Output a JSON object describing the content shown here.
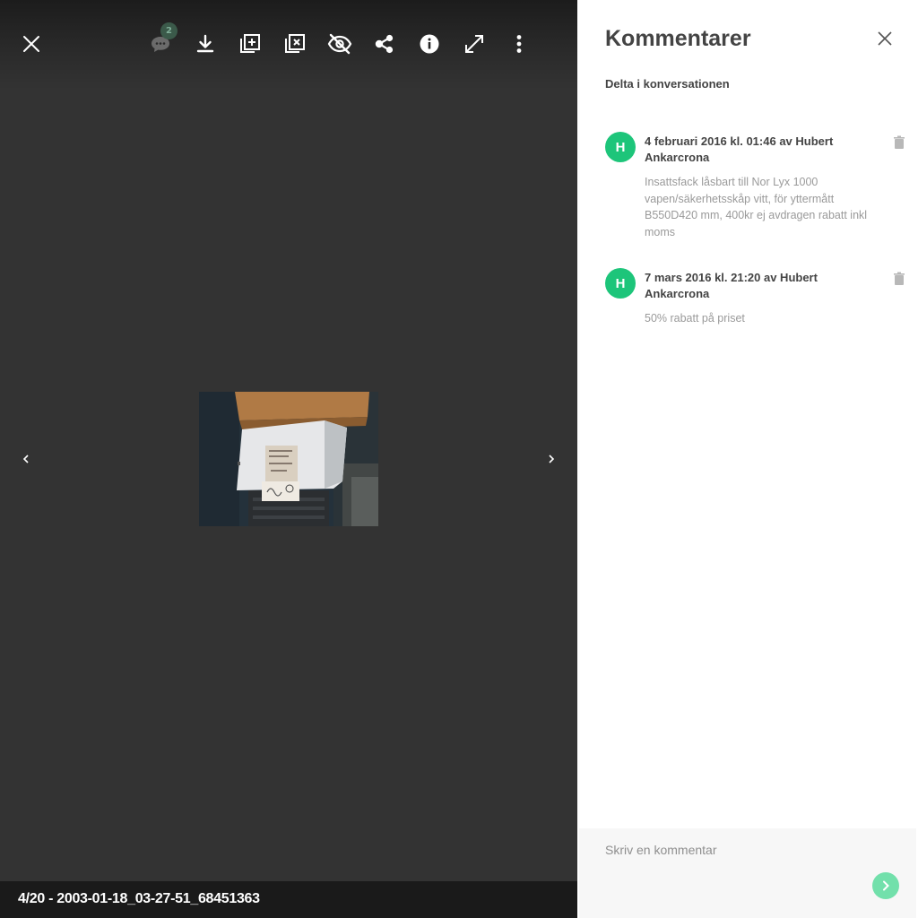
{
  "viewer": {
    "comment_count": "2",
    "footer_title": "4/20 - 2003-01-18_03-27-51_68451363",
    "icons": {
      "close": "close-icon",
      "comments": "comment-icon",
      "download": "download-icon",
      "add_to_album": "add-to-album-icon",
      "remove_from_album": "remove-from-album-icon",
      "hide": "eye-off-icon",
      "share": "share-icon",
      "info": "info-icon",
      "fullscreen": "fullscreen-icon",
      "more": "more-vertical-icon",
      "prev": "chevron-left-icon",
      "next": "chevron-right-icon"
    }
  },
  "panel": {
    "title": "Kommentarer",
    "subtitle": "Delta i konversationen",
    "comments": [
      {
        "initial": "H",
        "meta": "4 februari 2016 kl. 01:46 av Hubert Ankarcrona",
        "text": "Insattsfack låsbart till Nor Lyx 1000 vapen/säkerhetsskåp vitt, för yttermått B550D420 mm, 400kr ej avdragen rabatt inkl moms"
      },
      {
        "initial": "H",
        "meta": "7 mars 2016 kl. 21:20 av Hubert Ankarcrona",
        "text": "50% rabatt på priset"
      }
    ],
    "input_placeholder": "Skriv en kommentar"
  },
  "colors": {
    "viewer_bg": "#333333",
    "avatar": "#1dc57a",
    "send_button": "#72e0ab",
    "badge": "#3b5a4a"
  }
}
